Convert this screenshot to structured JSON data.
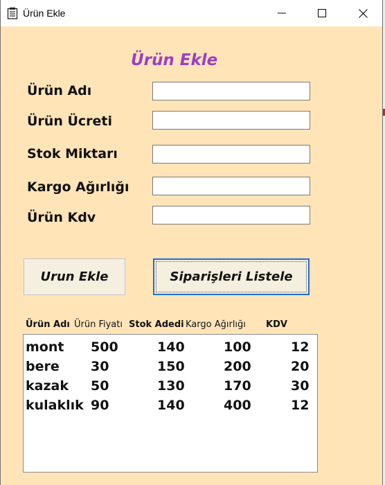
{
  "window": {
    "title": "Ürün Ekle",
    "icons": {
      "app": "form-icon",
      "minimize": "minimize-icon",
      "maximize": "maximize-icon",
      "close": "close-icon"
    }
  },
  "form": {
    "heading": "Ürün Ekle",
    "fields": [
      {
        "label": "Ürün Adı",
        "value": ""
      },
      {
        "label": "Ürün Ücreti",
        "value": ""
      },
      {
        "label": "Stok Miktarı",
        "value": ""
      },
      {
        "label": "Kargo Ağırlığı",
        "value": ""
      },
      {
        "label": "Ürün Kdv",
        "value": ""
      }
    ],
    "add_button": "Urun Ekle",
    "list_button": "Siparişleri Listele"
  },
  "table": {
    "headers": [
      "Ürün Adı",
      "Ürün Fiyatı",
      "Stok Adedi",
      "Kargo Ağırlığı",
      "KDV"
    ],
    "rows": [
      [
        "mont",
        "500",
        "140",
        "100",
        "12"
      ],
      [
        "bere",
        "30",
        "150",
        "200",
        "20"
      ],
      [
        "kazak",
        "50",
        "130",
        "170",
        "30"
      ],
      [
        "kulaklık",
        "90",
        "140",
        "400",
        "12"
      ]
    ]
  },
  "colors": {
    "form_background": "#ffe4b8",
    "heading": "#9b3fc2",
    "button_background": "#f4efdf",
    "focus_border": "#1e6fd0"
  }
}
